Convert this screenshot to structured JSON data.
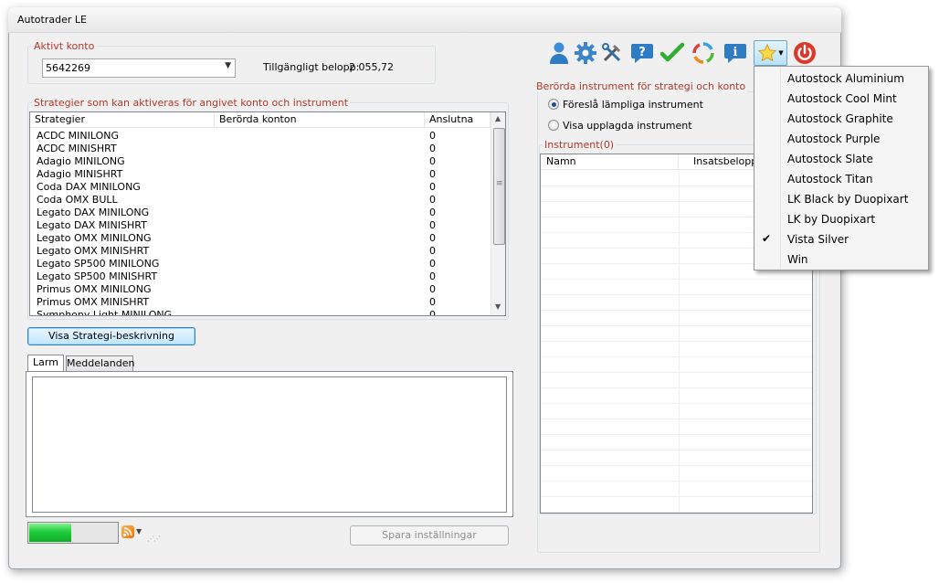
{
  "window": {
    "title": "Autotrader LE"
  },
  "account": {
    "legend": "Aktivt konto",
    "selected": "5642269",
    "balance_label": "Tillgängligt belopp:",
    "balance_value": "2 055,72"
  },
  "strategies": {
    "legend": "Strategier som kan aktiveras för angivet konto och instrument",
    "columns": [
      "Strategier",
      "Berörda konton",
      "Anslutna"
    ],
    "rows": [
      [
        "ACDC MINILONG",
        "",
        "0"
      ],
      [
        "ACDC MINISHRT",
        "",
        "0"
      ],
      [
        "Adagio MINILONG",
        "",
        "0"
      ],
      [
        "Adagio MINISHRT",
        "",
        "0"
      ],
      [
        "Coda DAX MINILONG",
        "",
        "0"
      ],
      [
        "Coda OMX BULL",
        "",
        "0"
      ],
      [
        "Legato DAX MINILONG",
        "",
        "0"
      ],
      [
        "Legato DAX MINISHRT",
        "",
        "0"
      ],
      [
        "Legato OMX MINILONG",
        "",
        "0"
      ],
      [
        "Legato OMX MINISHRT",
        "",
        "0"
      ],
      [
        "Legato SP500 MINILONG",
        "",
        "0"
      ],
      [
        "Legato SP500 MINISHRT",
        "",
        "0"
      ],
      [
        "Primus OMX MINILONG",
        "",
        "0"
      ],
      [
        "Primus OMX MINISHRT",
        "",
        "0"
      ],
      [
        "Symphony Light MINILONG",
        "",
        "0"
      ]
    ],
    "show_description_button": "Visa Strategi-beskrivning"
  },
  "tabs": [
    "Larm",
    "Meddelanden"
  ],
  "status": {
    "progress": 0.48
  },
  "save_button": "Spara inställningar",
  "instruments": {
    "legend": "Berörda instrument för strategi och konto",
    "radio_suggest": "Föreslå lämpliga instrument",
    "radio_show": "Visa upplagda instrument",
    "list_legend": "Instrument(0)",
    "columns": [
      "Namn",
      "Insatsbelopp"
    ]
  },
  "toolbar": {
    "icons": [
      "user-icon",
      "settings-gear-icon",
      "tools-icon",
      "help-icon",
      "checkmark-icon",
      "refresh-icon",
      "info-icon",
      "theme-star-icon",
      "power-icon"
    ]
  },
  "theme_menu": {
    "items": [
      "Autostock Aluminium",
      "Autostock Cool Mint",
      "Autostock Graphite",
      "Autostock Purple",
      "Autostock Slate",
      "Autostock Titan",
      "LK Black by Duopixart",
      "LK by Duopixart",
      "Vista Silver",
      "Win"
    ],
    "checked": "Vista Silver",
    "check_glyph": "✔"
  },
  "colors": {
    "legend_red": "#b33a2a",
    "progress_green": "#1fcc3a",
    "selection_blue": "#3399ff"
  }
}
